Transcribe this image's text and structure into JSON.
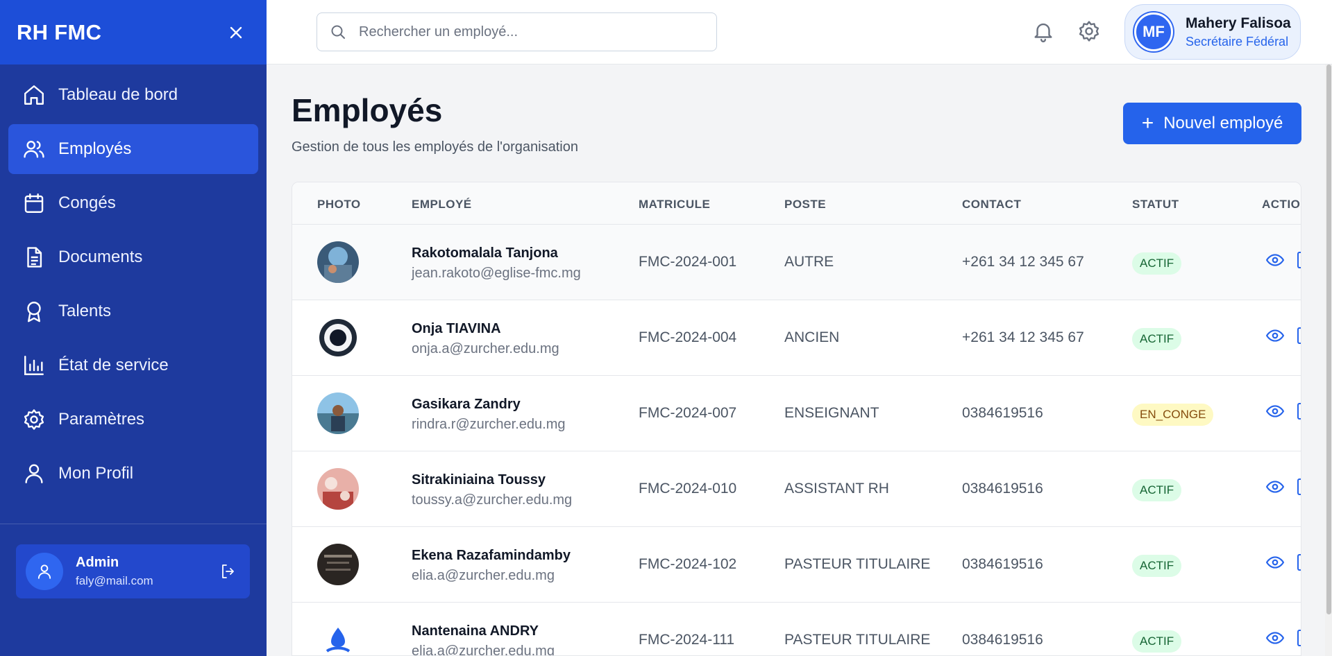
{
  "sidebar": {
    "title": "RH FMC",
    "items": [
      {
        "label": "Tableau de bord",
        "icon": "home-icon"
      },
      {
        "label": "Employés",
        "icon": "users-icon"
      },
      {
        "label": "Congés",
        "icon": "calendar-icon"
      },
      {
        "label": "Documents",
        "icon": "document-icon"
      },
      {
        "label": "Talents",
        "icon": "award-icon"
      },
      {
        "label": "État de service",
        "icon": "bar-chart-icon"
      },
      {
        "label": "Paramètres",
        "icon": "gear-icon"
      },
      {
        "label": "Mon Profil",
        "icon": "user-icon"
      }
    ],
    "active_item": "Employés",
    "user": {
      "name": "Admin",
      "email": "faly@mail.com"
    }
  },
  "topbar": {
    "search_placeholder": "Rechercher un employé...",
    "profile": {
      "initials": "MF",
      "name": "Mahery Falisoa",
      "role": "Secrétaire Fédéral"
    }
  },
  "page": {
    "title": "Employés",
    "subtitle": "Gestion de tous les employés de l'organisation",
    "new_button": "Nouvel employé"
  },
  "table": {
    "headers": [
      "PHOTO",
      "EMPLOYÉ",
      "MATRICULE",
      "POSTE",
      "CONTACT",
      "STATUT",
      "ACTIONS"
    ],
    "rows": [
      {
        "name": "Rakotomalala Tanjona",
        "email": "jean.rakoto@eglise-fmc.mg",
        "matricule": "FMC-2024-001",
        "poste": "AUTRE",
        "contact": "+261 34 12 345 67",
        "statut": "ACTIF"
      },
      {
        "name": "Onja TIAVINA",
        "email": "onja.a@zurcher.edu.mg",
        "matricule": "FMC-2024-004",
        "poste": "ANCIEN",
        "contact": "+261 34 12 345 67",
        "statut": "ACTIF"
      },
      {
        "name": "Gasikara Zandry",
        "email": "rindra.r@zurcher.edu.mg",
        "matricule": "FMC-2024-007",
        "poste": "ENSEIGNANT",
        "contact": "0384619516",
        "statut": "EN_CONGE"
      },
      {
        "name": "Sitrakiniaina Toussy",
        "email": "toussy.a@zurcher.edu.mg",
        "matricule": "FMC-2024-010",
        "poste": "ASSISTANT RH",
        "contact": "0384619516",
        "statut": "ACTIF"
      },
      {
        "name": "Ekena Razafamindamby",
        "email": "elia.a@zurcher.edu.mg",
        "matricule": "FMC-2024-102",
        "poste": "PASTEUR TITULAIRE",
        "contact": "0384619516",
        "statut": "ACTIF"
      },
      {
        "name": "Nantenaina ANDRY",
        "email": "elia.a@zurcher.edu.mg",
        "matricule": "FMC-2024-111",
        "poste": "PASTEUR TITULAIRE",
        "contact": "0384619516",
        "statut": "ACTIF"
      }
    ]
  },
  "colors": {
    "sidebar": "#1e3a9e",
    "accent": "#2563eb",
    "actif_bg": "#dcfce7",
    "conge_bg": "#fef9c3"
  }
}
